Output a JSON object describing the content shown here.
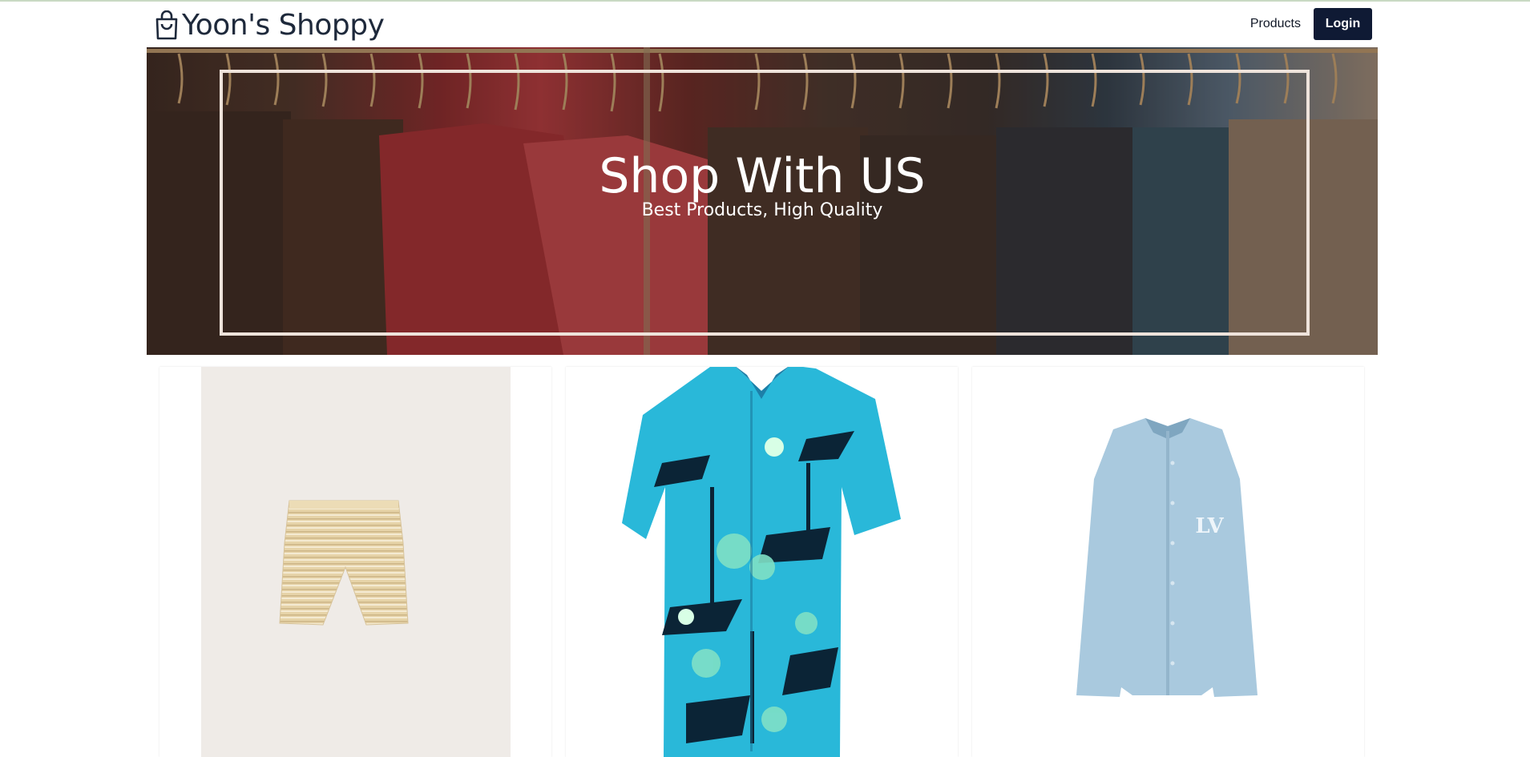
{
  "brand": {
    "name": "Yoon's Shoppy",
    "icon": "shopping-bag-icon"
  },
  "nav": {
    "products_label": "Products",
    "login_label": "Login"
  },
  "hero": {
    "title": "Shop With US",
    "subtitle": "Best Products, High Quality"
  },
  "products": [
    {
      "image": "tweed-shorts"
    },
    {
      "image": "hawaiian-shirt"
    },
    {
      "image": "light-blue-shirt",
      "logo_text": "LV"
    }
  ],
  "colors": {
    "primary": "#0f1a34",
    "text": "#1e293b"
  }
}
